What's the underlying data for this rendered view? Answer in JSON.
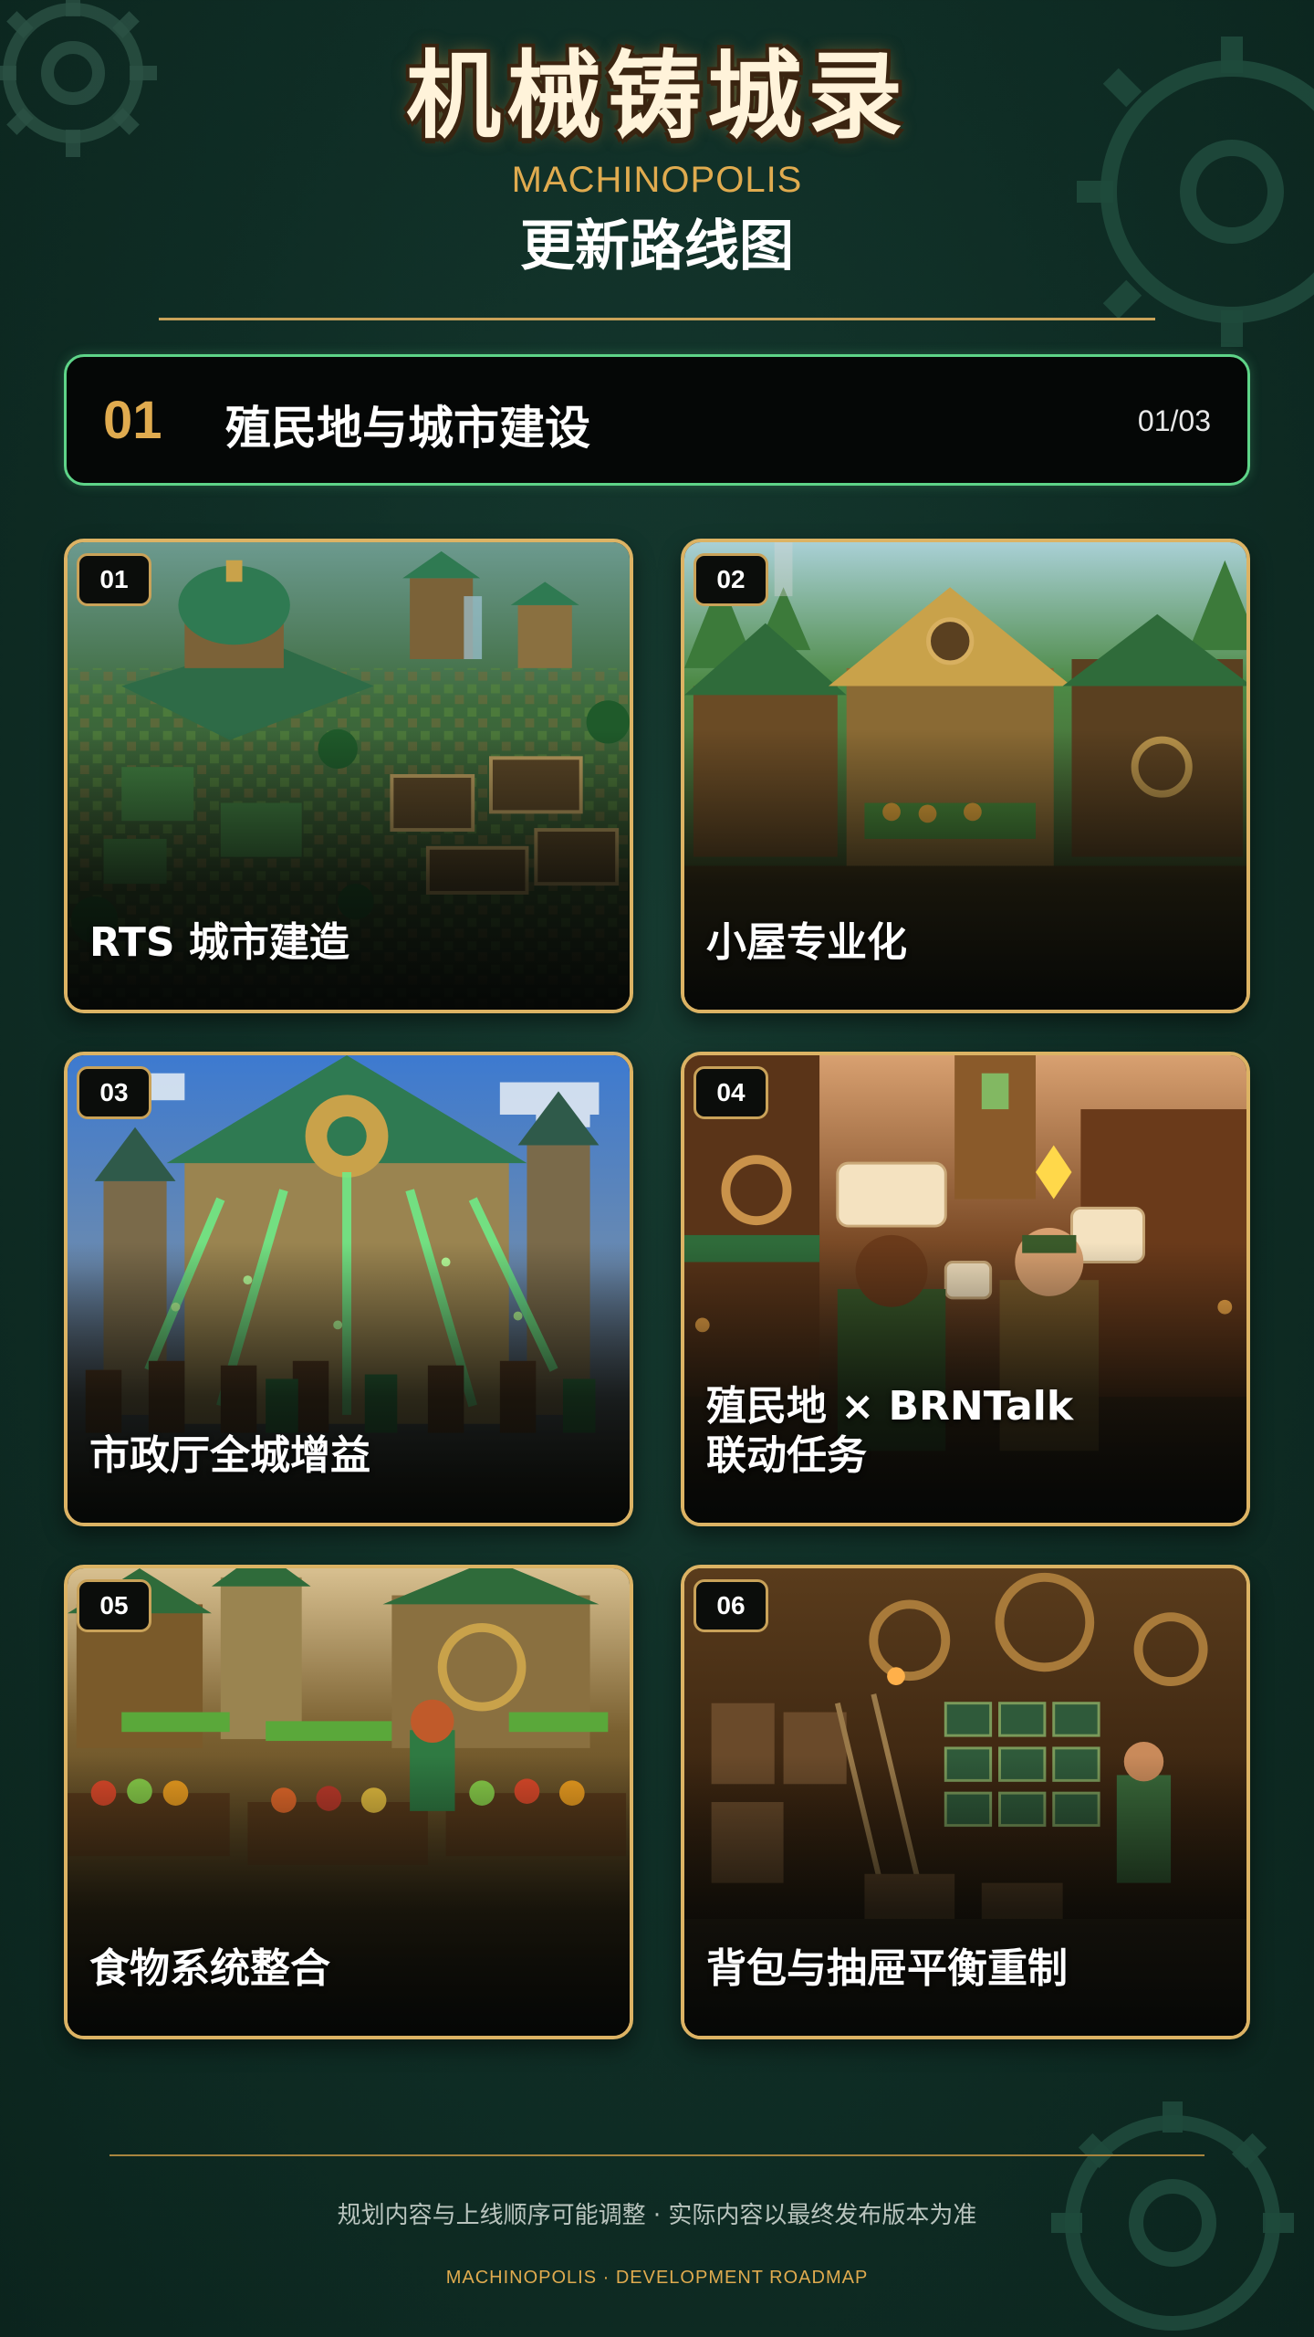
{
  "header": {
    "title": "机械铸城录",
    "subtitle_en": "MACHINOPOLIS",
    "subtitle_cn": "更新路线图"
  },
  "section": {
    "number": "01",
    "title": "殖民地与城市建设",
    "page": "01/03",
    "accent_color": "#5ed488"
  },
  "cards": [
    {
      "badge": "01",
      "label_lines": [
        "RTS 城市建造"
      ]
    },
    {
      "badge": "02",
      "label_lines": [
        "小屋专业化"
      ]
    },
    {
      "badge": "03",
      "label_lines": [
        "市政厅全城增益"
      ]
    },
    {
      "badge": "04",
      "label_lines": [
        "殖民地 × BRNTalk",
        "联动任务"
      ]
    },
    {
      "badge": "05",
      "label_lines": [
        "食物系统整合"
      ]
    },
    {
      "badge": "06",
      "label_lines": [
        "背包与抽屉平衡重制"
      ]
    }
  ],
  "footer": {
    "disclaimer": "规划内容与上线顺序可能调整 · 实际内容以最终发布版本为准",
    "tagline": "MACHINOPOLIS · DEVELOPMENT ROADMAP"
  },
  "colors": {
    "background": "#0f2d25",
    "gold": "#dcb364",
    "gold_text": "#e0ab4f"
  }
}
